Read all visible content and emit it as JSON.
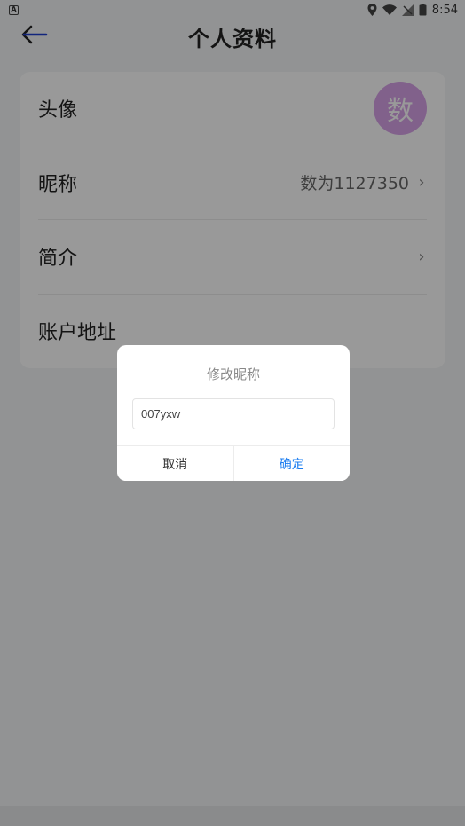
{
  "status_bar": {
    "left_icon": "A",
    "time": "8:54",
    "icons": [
      "location-icon",
      "wifi-icon",
      "no-signal-icon",
      "battery-icon"
    ]
  },
  "app_bar": {
    "title": "个人资料",
    "back_icon": "arrow-left-icon"
  },
  "profile": {
    "rows": [
      {
        "label": "头像",
        "avatar_text": "数",
        "avatar_color": "#d7a2e8"
      },
      {
        "label": "昵称",
        "value": "数为1127350",
        "chevron": "›"
      },
      {
        "label": "简介",
        "value": "",
        "chevron": "›"
      },
      {
        "label": "账户地址",
        "value": ""
      }
    ]
  },
  "dialog": {
    "title": "修改昵称",
    "input_value": "007yxw",
    "cancel_label": "取消",
    "confirm_label": "确定",
    "confirm_color": "#1a7cf0"
  }
}
